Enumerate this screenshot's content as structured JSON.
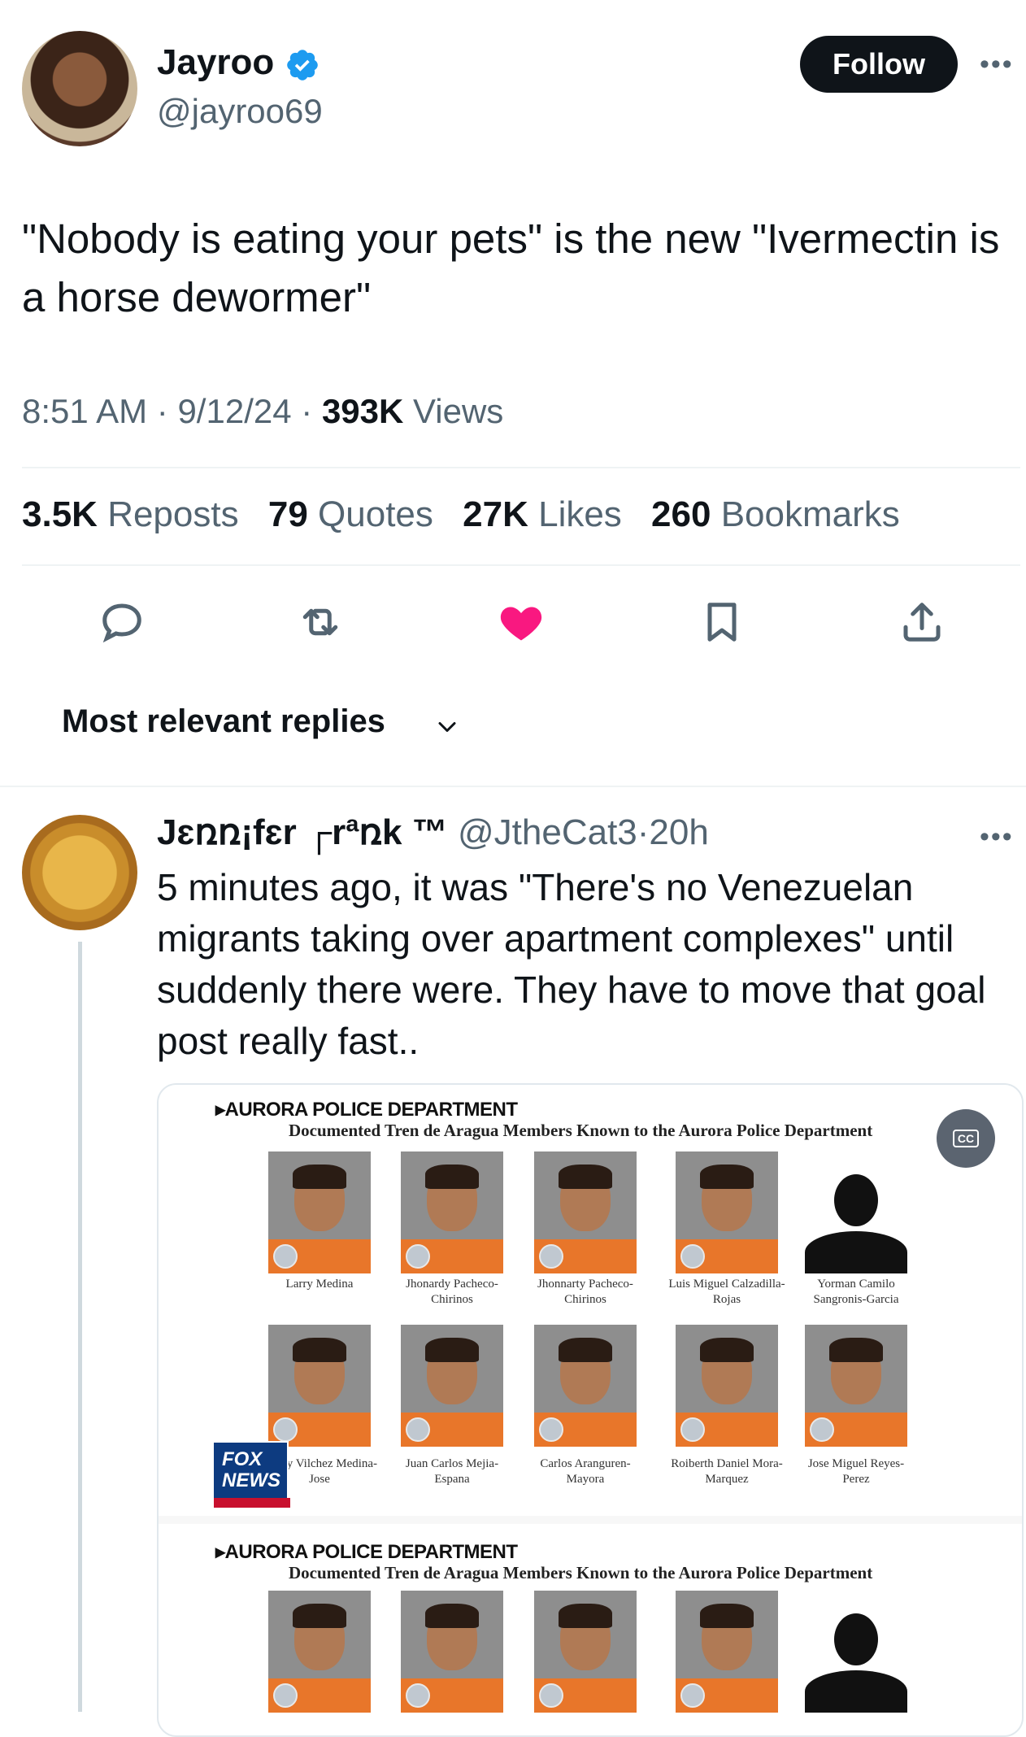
{
  "tweet": {
    "author_name": "Jayroo",
    "author_handle": "@jayroo69",
    "follow_label": "Follow",
    "more_label": "•••",
    "text": "\"Nobody is eating your pets\" is the new \"Ivermectin is a horse dewormer\"",
    "time": "8:51 AM",
    "date": "9/12/24",
    "views_count": "393K",
    "views_label": "Views",
    "sep": "·"
  },
  "stats": [
    {
      "count": "3.5K",
      "label": "Reposts"
    },
    {
      "count": "79",
      "label": "Quotes"
    },
    {
      "count": "27K",
      "label": "Likes"
    },
    {
      "count": "260",
      "label": "Bookmarks"
    }
  ],
  "actions": {
    "reply_icon": "reply-icon",
    "repost_icon": "repost-icon",
    "like_icon": "heart-icon",
    "bookmark_icon": "bookmark-icon",
    "share_icon": "share-icon",
    "like_color": "#f91880"
  },
  "replies_sort": {
    "label": "Most relevant replies"
  },
  "reply": {
    "author_name": "Jɛռռ¡fɛr ┌rªռk ™",
    "author_handle": "@JtheCat3",
    "sep": "·",
    "age": "20h",
    "more_label": "•••",
    "text": "5 minutes ago, it was \"There's no Venezuelan migrants taking over apartment complexes\" until suddenly there were.   They have to move that goal post really fast..",
    "media": {
      "header": "▸AURORA POLICE DEPARTMENT",
      "subheader": "Documented Tren de Aragua Members Known to the Aurora Police Department",
      "cc_label": "CC",
      "watermark": "FOX NEWS",
      "row1": [
        "Larry Medina",
        "Jhonardy Pacheco-Chirinos",
        "Jhonnarty Pacheco-Chirinos",
        "Luis Miguel Calzadilla-Rojas",
        "Yorman Camilo Sangronis-Garcia"
      ],
      "row2": [
        "Andry Vilchez Medina-Jose",
        "Juan Carlos Mejia-Espana",
        "Carlos Aranguren-Mayora",
        "Roiberth Daniel Mora-Marquez",
        "Jose Miguel Reyes-Perez"
      ]
    }
  }
}
